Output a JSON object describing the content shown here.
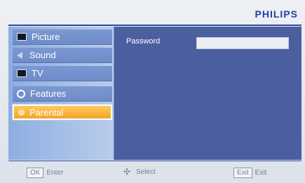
{
  "brand": "PHILIPS",
  "menu": {
    "items": [
      {
        "label": "Picture",
        "icon": "tv-icon"
      },
      {
        "label": "Sound",
        "icon": "speaker-icon"
      },
      {
        "label": "TV",
        "icon": "tv-icon"
      },
      {
        "label": "Features",
        "icon": "gear-icon"
      },
      {
        "label": "Parental",
        "icon": "lock-icon",
        "selected": true
      }
    ]
  },
  "panel": {
    "password_label": "Password",
    "password_value": ""
  },
  "footer": {
    "ok_key": "OK",
    "ok_action": "Enter",
    "select_action": "Select",
    "exit_key": "Exit",
    "exit_action": "Exit"
  },
  "colors": {
    "brand": "#1f3fa8",
    "panel": "#4b5ea0",
    "menu_item": "#7b98d3",
    "selected": "#f0a52a"
  }
}
